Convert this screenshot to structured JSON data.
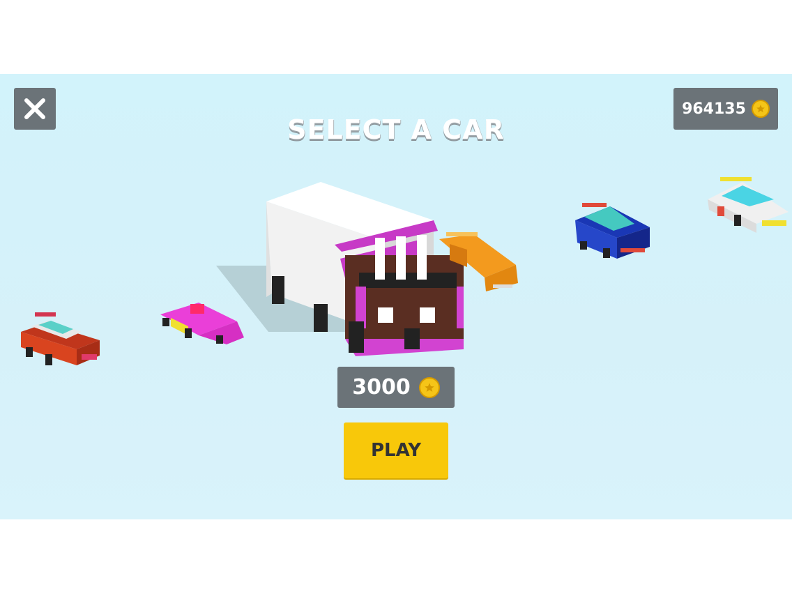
{
  "screen": {
    "title": "SELECT A CAR",
    "close_icon": "close-icon",
    "coin_icon": "coin-star-icon"
  },
  "wallet": {
    "balance": "964135"
  },
  "selected_car": {
    "price": "3000",
    "name_hint": "truck"
  },
  "play_button": {
    "label": "PLAY"
  },
  "colors": {
    "background": "#d3f2fa",
    "panel": "#6b7378",
    "play": "#f8c80a",
    "coin": "#f5c518"
  },
  "cars": [
    "red-sports-car",
    "pink-kart",
    "white-box-truck",
    "orange-car",
    "blue-hatchback",
    "white-racer"
  ]
}
